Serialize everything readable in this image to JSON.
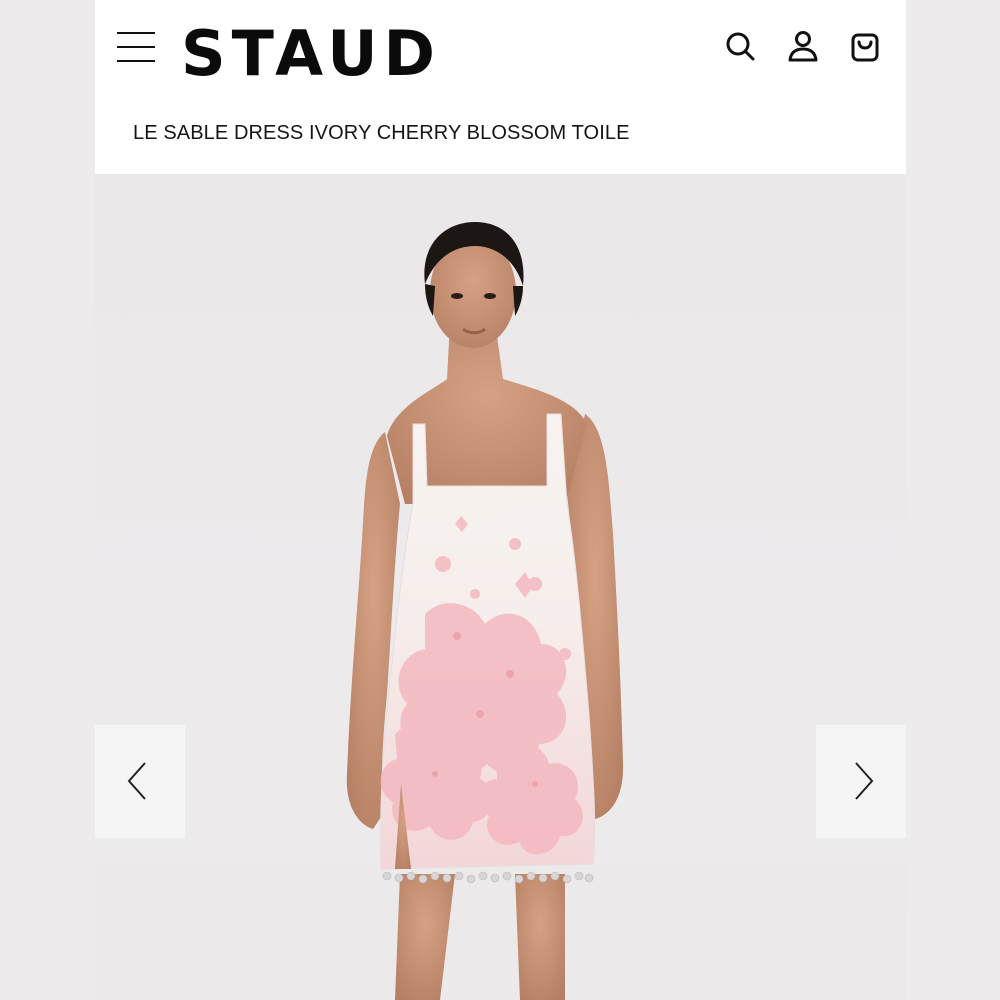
{
  "header": {
    "brand": "STAUD",
    "icons": [
      "menu-icon",
      "search-icon",
      "account-icon",
      "shopping-bag-icon"
    ]
  },
  "product": {
    "title": "LE SABLE DRESS IVORY CHERRY BLOSSOM TOILE"
  },
  "gallery": {
    "image_alt": "Model wearing ivory beaded mini dress with pink cherry blossom toile",
    "controls": [
      "chevron-left-icon",
      "chevron-right-icon"
    ]
  },
  "colors": {
    "brand_text": "#0b0b0b",
    "gallery_bg": "#ebe8ea",
    "dress_ivory": "#f6f1ed",
    "dress_pink": "#f3bdc2"
  }
}
